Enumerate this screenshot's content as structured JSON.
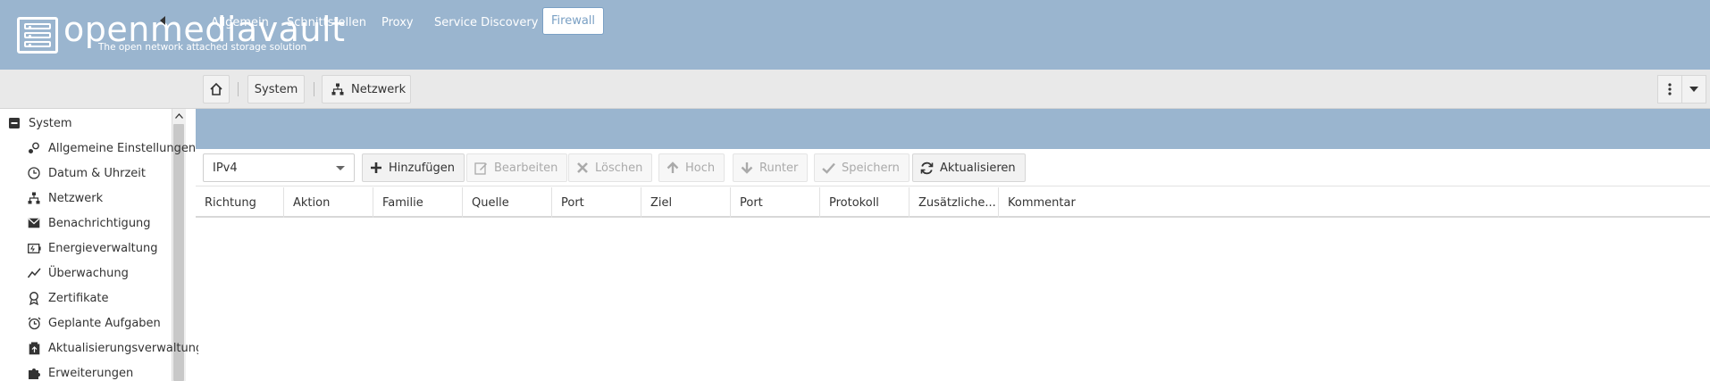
{
  "header": {
    "brand": "openmediavault",
    "tagline": "The open network attached storage solution"
  },
  "breadcrumb": {
    "system": "System",
    "network": "Netzwerk"
  },
  "sidebar": {
    "root": "System",
    "items": [
      {
        "label": "Allgemeine Einstellungen",
        "icon": "user-gear-icon"
      },
      {
        "label": "Datum & Uhrzeit",
        "icon": "clock-icon"
      },
      {
        "label": "Netzwerk",
        "icon": "network-icon"
      },
      {
        "label": "Benachrichtigung",
        "icon": "envelope-icon"
      },
      {
        "label": "Energieverwaltung",
        "icon": "battery-icon"
      },
      {
        "label": "Überwachung",
        "icon": "chart-line-icon"
      },
      {
        "label": "Zertifikate",
        "icon": "certificate-icon"
      },
      {
        "label": "Geplante Aufgaben",
        "icon": "alarm-clock-icon"
      },
      {
        "label": "Aktualisierungsverwaltung",
        "icon": "update-icon"
      },
      {
        "label": "Erweiterungen",
        "icon": "puzzle-icon"
      }
    ]
  },
  "tabs": [
    {
      "label": "Allgemein"
    },
    {
      "label": "Schnittstellen"
    },
    {
      "label": "Proxy"
    },
    {
      "label": "Service Discovery"
    },
    {
      "label": "Firewall",
      "active": true
    }
  ],
  "toolbar": {
    "select_value": "IPv4",
    "add": "Hinzufügen",
    "edit": "Bearbeiten",
    "delete": "Löschen",
    "up": "Hoch",
    "down": "Runter",
    "save": "Speichern",
    "refresh": "Aktualisieren"
  },
  "columns": [
    "Richtung",
    "Aktion",
    "Familie",
    "Quelle",
    "Port",
    "Ziel",
    "Port",
    "Protokoll",
    "Zusätzliche...",
    "Kommentar"
  ],
  "colors": {
    "header_bg": "#9ab5cf",
    "active_tab": "#7aa0c4"
  }
}
